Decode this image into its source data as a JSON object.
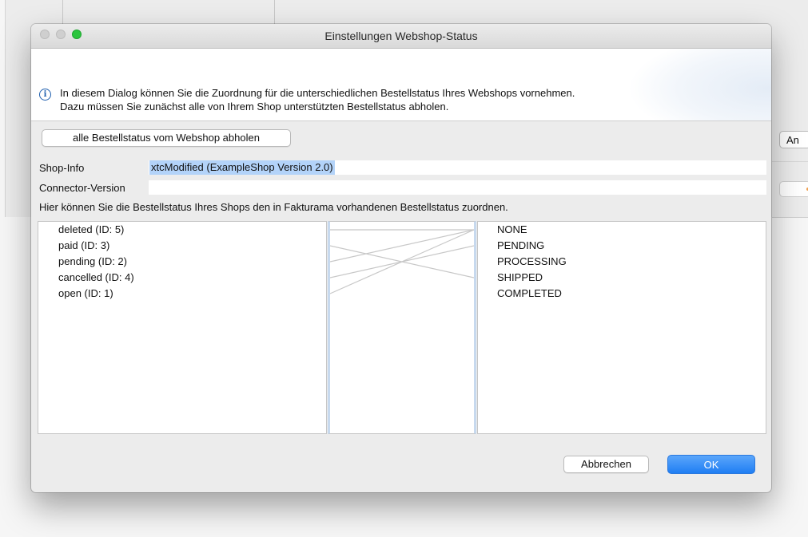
{
  "background_window": {
    "button_partial_label": "An"
  },
  "dialog": {
    "title": "Einstellungen Webshop-Status",
    "info": {
      "icon": "info-icon",
      "line1": "In diesem Dialog können Sie die Zuordnung für die unterschiedlichen Bestellstatus Ihres Webshops vornehmen.",
      "line2": "Dazu müssen Sie zunächst alle von Ihrem Shop unterstützten Bestellstatus abholen."
    },
    "fetch_button": "alle Bestellstatus vom Webshop abholen",
    "shop_info": {
      "label": "Shop-Info",
      "value": "xtcModified (ExampleShop Version 2.0)"
    },
    "connector_version": {
      "label": "Connector-Version",
      "value": ""
    },
    "mapping_hint": "Hier können Sie die Bestellstatus Ihres Shops den in Fakturama vorhandenen Bestellstatus zuordnen.",
    "shop_statuses": [
      "deleted (ID: 5)",
      "paid (ID: 3)",
      "pending (ID: 2)",
      "cancelled (ID: 4)",
      "open (ID: 1)"
    ],
    "fakturama_statuses": [
      "NONE",
      "PENDING",
      "PROCESSING",
      "SHIPPED",
      "COMPLETED"
    ],
    "mappings": [
      {
        "from": "deleted (ID: 5)",
        "to": "NONE"
      },
      {
        "from": "paid (ID: 3)",
        "to": "SHIPPED"
      },
      {
        "from": "pending (ID: 2)",
        "to": "NONE"
      },
      {
        "from": "cancelled (ID: 4)",
        "to": "PENDING"
      },
      {
        "from": "open (ID: 1)",
        "to": "NONE"
      }
    ],
    "cancel_button": "Abbrechen",
    "ok_button": "OK"
  }
}
